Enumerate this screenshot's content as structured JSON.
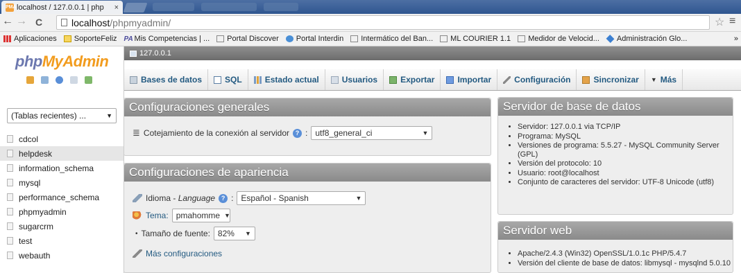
{
  "browser": {
    "tab_title": "localhost / 127.0.0.1 | php",
    "tab_close": "×",
    "tab_favicon": "PMA",
    "url_host": "localhost",
    "url_path": "/phpmyadmin/",
    "nav_back": "←",
    "nav_forward": "→",
    "nav_reload": "C",
    "star": "☆",
    "menu": "≡",
    "bookmarks": [
      {
        "label": "Aplicaciones",
        "icon": "apps-icon"
      },
      {
        "label": "SoporteFeliz",
        "icon": "folder-icon"
      },
      {
        "label": "Mis Competencias | ...",
        "icon": "pa-icon"
      },
      {
        "label": "Portal Discover",
        "icon": "page-icon"
      },
      {
        "label": "Portal Interdin",
        "icon": "globe-icon"
      },
      {
        "label": "Intermático del Ban...",
        "icon": "page-icon"
      },
      {
        "label": "ML COURIER 1.1",
        "icon": "page-icon"
      },
      {
        "label": "Medidor de Velocid...",
        "icon": "page-icon"
      },
      {
        "label": "Administración Glo...",
        "icon": "diamond-icon"
      }
    ],
    "bookmarks_more": "»"
  },
  "sidebar": {
    "logo_php": "php",
    "logo_myadmin": "MyAdmin",
    "recent_select": "(Tablas recientes) ...",
    "databases": [
      "cdcol",
      "helpdesk",
      "information_schema",
      "mysql",
      "performance_schema",
      "phpmyadmin",
      "sugarcrm",
      "test",
      "webauth"
    ],
    "selected_db": "helpdesk"
  },
  "server_bar": "127.0.0.1",
  "tabs": [
    {
      "label": "Bases de datos",
      "icon": "database-icon"
    },
    {
      "label": "SQL",
      "icon": "sql-icon"
    },
    {
      "label": "Estado actual",
      "icon": "status-icon"
    },
    {
      "label": "Usuarios",
      "icon": "users-icon"
    },
    {
      "label": "Exportar",
      "icon": "export-icon"
    },
    {
      "label": "Importar",
      "icon": "import-icon"
    },
    {
      "label": "Configuración",
      "icon": "wrench-icon"
    },
    {
      "label": "Sincronizar",
      "icon": "sync-icon"
    },
    {
      "label": "Más",
      "icon": "more-caret-icon"
    }
  ],
  "general": {
    "title": "Configuraciones generales",
    "collation_label": "Cotejamiento de la conexión al servidor",
    "collation_value": "utf8_general_ci",
    "colon": ":"
  },
  "appearance": {
    "title": "Configuraciones de apariencia",
    "lang_label_prefix": "Idioma - ",
    "lang_label_em": "Language",
    "lang_value": "Español - Spanish",
    "theme_label": "Tema:",
    "theme_value": "pmahomme",
    "fontsize_label": "Tamaño de fuente:",
    "fontsize_value": "82%",
    "more_settings": "Más configuraciones",
    "colon": ":"
  },
  "db_server": {
    "title": "Servidor de base de datos",
    "items": [
      "Servidor: 127.0.0.1 via TCP/IP",
      "Programa: MySQL",
      "Versiones de programa: 5.5.27 - MySQL Community Server (GPL)",
      "Versión del protocolo: 10",
      "Usuario: root@localhost",
      "Conjunto de caracteres del servidor: UTF-8 Unicode (utf8)"
    ]
  },
  "web_server": {
    "title": "Servidor web",
    "items": [
      "Apache/2.4.3 (Win32) OpenSSL/1.0.1c PHP/5.4.7",
      "Versión del cliente de base de datos: libmysql - mysqlnd 5.0.10"
    ]
  },
  "colors": {
    "accent_orange": "#f29c1e",
    "logo_php": "#6c78af",
    "tab_text": "#235a81"
  }
}
